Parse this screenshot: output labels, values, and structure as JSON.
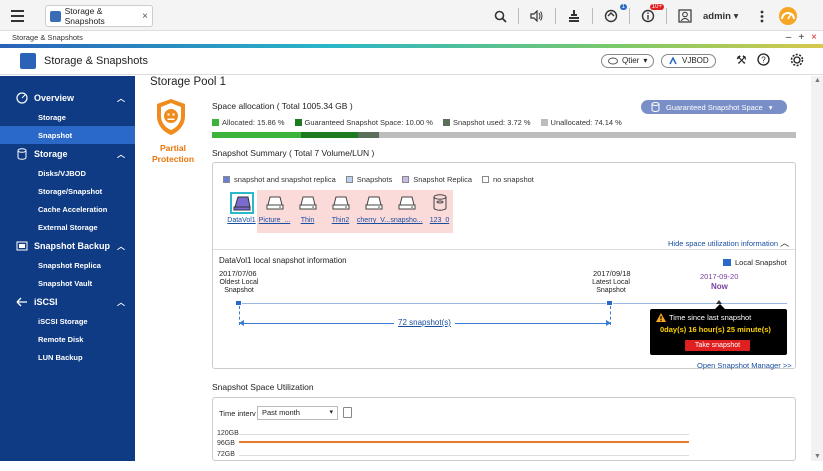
{
  "topbar": {
    "tab_label": "Storage & Snapshots",
    "tab_close": "×",
    "user": "admin ▾",
    "badge_updates": "1",
    "badge_notifications": "10+"
  },
  "window": {
    "title": "Storage & Snapshots",
    "controls": [
      "–",
      "+",
      "×"
    ]
  },
  "app": {
    "title": "Storage & Snapshots",
    "qtier_label": "Qtier",
    "vjbod_label": "VJBOD"
  },
  "sidebar": {
    "groups": [
      {
        "label": "Overview",
        "items": [
          "Storage",
          "Snapshot"
        ]
      },
      {
        "label": "Storage",
        "items": [
          "Disks/VJBOD",
          "Storage/Snapshot",
          "Cache Acceleration",
          "External Storage"
        ]
      },
      {
        "label": "Snapshot Backup",
        "items": [
          "Snapshot Replica",
          "Snapshot Vault"
        ]
      },
      {
        "label": "iSCSI",
        "items": [
          "iSCSI Storage",
          "Remote Disk",
          "LUN Backup"
        ]
      }
    ]
  },
  "pool": {
    "title": "Storage Pool 1",
    "protection": "Partial Protection",
    "space_allocation": "Space allocation ( Total 1005.34 GB )",
    "guaranteed_button": "Guaranteed Snapshot Space",
    "legend": [
      {
        "label": "Allocated: 15.86 %",
        "color": "#3cb43c"
      },
      {
        "label": "Guaranteed Snapshot Space: 10.00 %",
        "color": "#1e7a1e"
      },
      {
        "label": "Snapshot used: 3.72 %",
        "color": "#5a6e5a"
      },
      {
        "label": "Unallocated: 74.14 %",
        "color": "#bdbdbd"
      }
    ],
    "bar_fractions": [
      0.1586,
      0.1,
      0.0372,
      0.7414
    ]
  },
  "summary": {
    "title": "Snapshot Summary ( Total 7 Volume/LUN )",
    "legend": [
      {
        "label": "snapshot and snapshot replica",
        "color": "#6a7ed6"
      },
      {
        "label": "Snapshots",
        "color": "#bcd0f0"
      },
      {
        "label": "Snapshot Replica",
        "color": "#c9b7e8"
      },
      {
        "label": "no snapshot",
        "color": "#ffffff"
      }
    ],
    "volumes": [
      "DataVol1",
      "Picture_...",
      "Thin",
      "Thin2",
      "cherry_V...",
      "snapsho...",
      "123_0"
    ],
    "hide_link": "Hide space utilization information",
    "local_info_title": "DataVol1 local snapshot information",
    "local_snapshot_legend": "Local Snapshot",
    "oldest_date": "2017/07/06",
    "oldest_label": "Oldest Local Snapshot",
    "latest_date": "2017/09/18",
    "latest_label": "Latest Local Snapshot",
    "now_date": "2017-09-20",
    "now_label": "Now",
    "snapshot_count": "72 snapshot(s)",
    "popup_title": "Time since last snapshot",
    "popup_time": "0day(s) 16 hour(s) 25 minute(s)",
    "popup_button": "Take snapshot",
    "open_manager": "Open Snapshot Manager >>"
  },
  "utilization": {
    "title": "Snapshot Space Utilization",
    "time_interval_label": "Time interv",
    "time_interval_value": "Past month",
    "y_labels": [
      "120GB",
      "96GB",
      "72GB"
    ]
  }
}
